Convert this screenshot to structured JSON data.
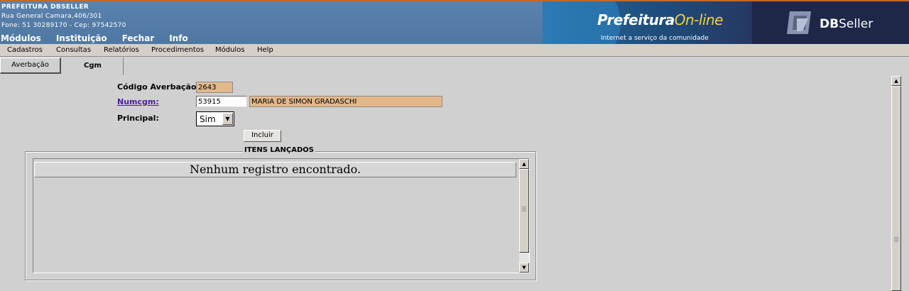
{
  "header": {
    "institution_name": "PREFEITURA DBSELLER",
    "address": "Rua General Camara,406/301",
    "contact": "Fone: 51 30289170  -  Cep: 97542570",
    "menu": [
      "Módulos",
      "Instituição",
      "Fechar",
      "Info"
    ],
    "brand_title_main": "Prefeitura",
    "brand_title_accent": "On-line",
    "brand_subtitle": "Internet a serviço da comunidade",
    "company_strong": "DB",
    "company_rest": "Seller"
  },
  "menubar": [
    "Cadastros",
    "Consultas",
    "Relatórios",
    "Procedimentos",
    "Módulos",
    "Help"
  ],
  "tabs": [
    {
      "label": "Averbação",
      "active": false
    },
    {
      "label": "Cgm",
      "active": true
    }
  ],
  "form": {
    "codigo_label": "Código Averbação:",
    "codigo_value": "2643",
    "numcgm_label": "Numcgm:",
    "numcgm_value": "53915",
    "nome_value": "MARIA DE SIMON GRADASCHI",
    "principal_label": "Principal:",
    "principal_value": "Sim",
    "incluir_label": "Incluir"
  },
  "items": {
    "legend": "ITENS LANÇADOS",
    "empty_message": "Nenhum registro encontrado."
  },
  "colors": {
    "header_bg": "#5a82ad",
    "readonly_field": "#e2b88a",
    "page_bg": "#d0d0d0",
    "link": "#4b1e9c"
  }
}
